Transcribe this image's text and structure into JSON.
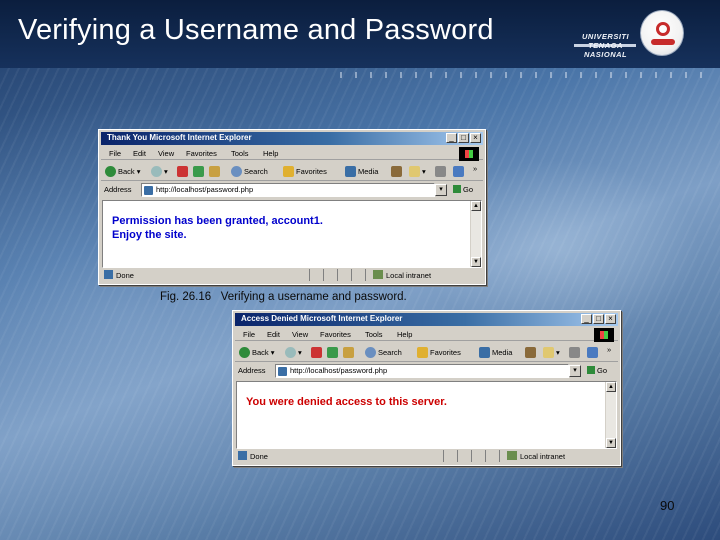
{
  "slide": {
    "title": "Verifying a Username and Password",
    "logo_text": [
      "UNIVERSITI",
      "TENAGA",
      "NASIONAL"
    ],
    "caption": "Fig. 26.16   Verifying a username and password.",
    "page_number": "90"
  },
  "window1": {
    "title": "Thank You   Microsoft Internet Explorer",
    "menu": [
      "File",
      "Edit",
      "View",
      "Favorites",
      "Tools",
      "Help"
    ],
    "toolbar": [
      "Back",
      "Search",
      "Favorites",
      "Media"
    ],
    "address_label": "Address",
    "address": "http://localhost/password.php",
    "go_label": "Go",
    "message_lines": [
      "Permission has been granted, account1.",
      "Enjoy the site."
    ],
    "message_color": "#0000cc",
    "status_left": "Done",
    "status_right": "Local intranet"
  },
  "window2": {
    "title": "Access Denied   Microsoft Internet Explorer",
    "menu": [
      "File",
      "Edit",
      "View",
      "Favorites",
      "Tools",
      "Help"
    ],
    "toolbar": [
      "Back",
      "Search",
      "Favorites",
      "Media"
    ],
    "address_label": "Address",
    "address": "http://localhost/password.php",
    "go_label": "Go",
    "message_lines": [
      "You were denied access to this server."
    ],
    "message_color": "#cc0000",
    "status_left": "Done",
    "status_right": "Local intranet"
  },
  "colors": {
    "title_bar": "#0a246a",
    "window_chrome": "#d4d0c8",
    "slide_header": "#0b1e3e"
  }
}
